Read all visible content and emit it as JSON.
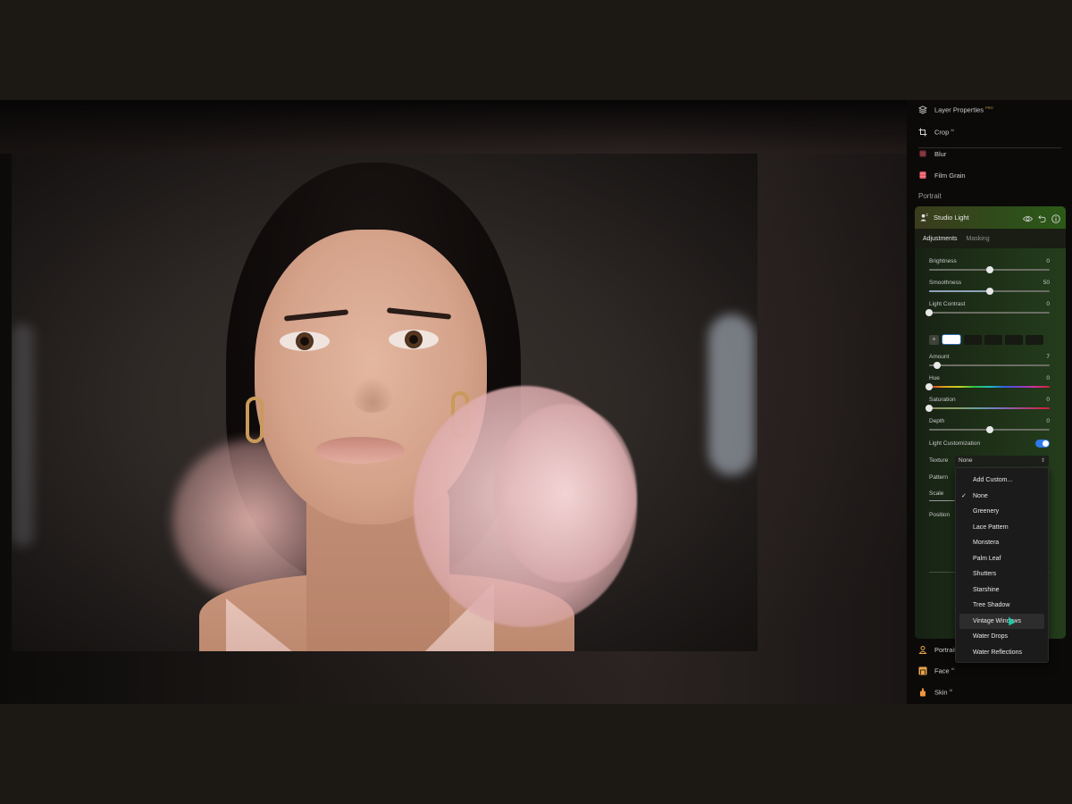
{
  "panel": {
    "tools": [
      {
        "label": "Layer Properties",
        "badge": "PRO",
        "icon": "layers-icon"
      },
      {
        "label": "Crop",
        "badge": "AI",
        "icon": "crop-icon"
      },
      {
        "label": "Blur",
        "badge": "",
        "icon": "blur-icon"
      },
      {
        "label": "Film Grain",
        "badge": "",
        "icon": "film-grain-icon"
      }
    ],
    "section_title": "Portrait",
    "studio_light": {
      "title": "Studio Light",
      "header_icons": [
        "eye-icon",
        "undo-icon",
        "info-icon"
      ],
      "tabs": [
        {
          "label": "Adjustments",
          "active": true
        },
        {
          "label": "Masking",
          "active": false
        }
      ],
      "sliders_top": [
        {
          "label": "Brightness",
          "value": "0",
          "position": 0.5
        },
        {
          "label": "Smoothness",
          "value": "50",
          "position": 0.5
        },
        {
          "label": "Light Contrast",
          "value": "0",
          "position": 0.0
        }
      ],
      "swatch_add": "+",
      "sliders_bottom": [
        {
          "label": "Amount",
          "value": "7",
          "position": 0.07
        },
        {
          "label": "Hue",
          "value": "0",
          "position": 0.0
        },
        {
          "label": "Saturation",
          "value": "0",
          "position": 0.0
        },
        {
          "label": "Depth",
          "value": "0",
          "position": 0.5
        }
      ],
      "light_customization": {
        "label": "Light Customization",
        "enabled": true
      },
      "texture": {
        "label": "Texture",
        "value": "None"
      },
      "pattern_label": "Pattern",
      "scale_label": "Scale",
      "position_label": "Position"
    },
    "bottom_tools": [
      {
        "label": "Portrait",
        "badge": "",
        "icon": "portrait-icon"
      },
      {
        "label": "Face",
        "badge": "AI",
        "icon": "face-icon"
      },
      {
        "label": "Skin",
        "badge": "AI",
        "icon": "skin-icon"
      }
    ]
  },
  "texture_menu": {
    "items": [
      {
        "label": "Add Custom...",
        "checked": false
      },
      {
        "label": "None",
        "checked": true
      },
      {
        "label": "Greenery",
        "checked": false
      },
      {
        "label": "Lace Pattern",
        "checked": false
      },
      {
        "label": "Monstera",
        "checked": false
      },
      {
        "label": "Palm Leaf",
        "checked": false
      },
      {
        "label": "Shutters",
        "checked": false
      },
      {
        "label": "Starshine",
        "checked": false
      },
      {
        "label": "Tree Shadow",
        "checked": false
      },
      {
        "label": "Vintage Windows",
        "checked": false,
        "hovered": true
      },
      {
        "label": "Water Drops",
        "checked": false
      },
      {
        "label": "Water Reflections",
        "checked": false
      }
    ],
    "check_glyph": "✓"
  },
  "colors": {
    "accent_blue": "#2d7ae8",
    "pro_badge": "#c9a640",
    "card_header_green": "#2f4d1a",
    "portrait_icon_orange": "#e9a34a"
  }
}
